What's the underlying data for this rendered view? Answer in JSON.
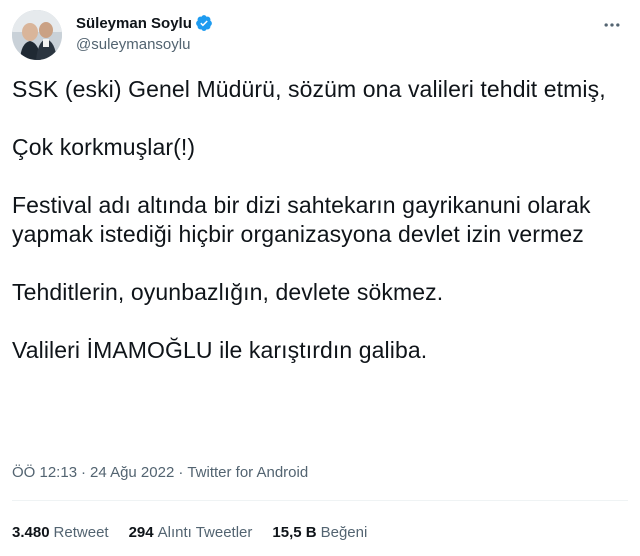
{
  "author": {
    "display_name": "Süleyman Soylu",
    "handle": "@suleymansoylu",
    "verified": true,
    "avatar_icon": "profile-photo",
    "verified_icon": "verified-badge-icon",
    "more_icon": "more-options-icon"
  },
  "tweet": {
    "paragraphs": [
      "SSK (eski) Genel Müdürü, sözüm ona valileri tehdit etmiş,",
      "Çok korkmuşlar(!)",
      "Festival adı altında bir dizi sahtekarın gayrikanuni olarak yapmak istediği hiçbir organizasyona devlet izin vermez",
      "Tehditlerin, oyunbazlığın, devlete sökmez.",
      "Valileri İMAMOĞLU ile karıştırdın galiba."
    ]
  },
  "meta": {
    "time": "ÖÖ 12:13",
    "separator": "·",
    "date": "24 Ağu 2022",
    "source": "Twitter for Android"
  },
  "stats": {
    "retweets": {
      "count": "3.480",
      "label": "Retweet"
    },
    "quotes": {
      "count": "294",
      "label": "Alıntı Tweetler"
    },
    "likes": {
      "count": "15,5 B",
      "label": "Beğeni"
    }
  },
  "colors": {
    "text_primary": "#0f1419",
    "text_secondary": "#536471",
    "verified_blue": "#1d9bf0",
    "divider": "#eff3f4"
  }
}
